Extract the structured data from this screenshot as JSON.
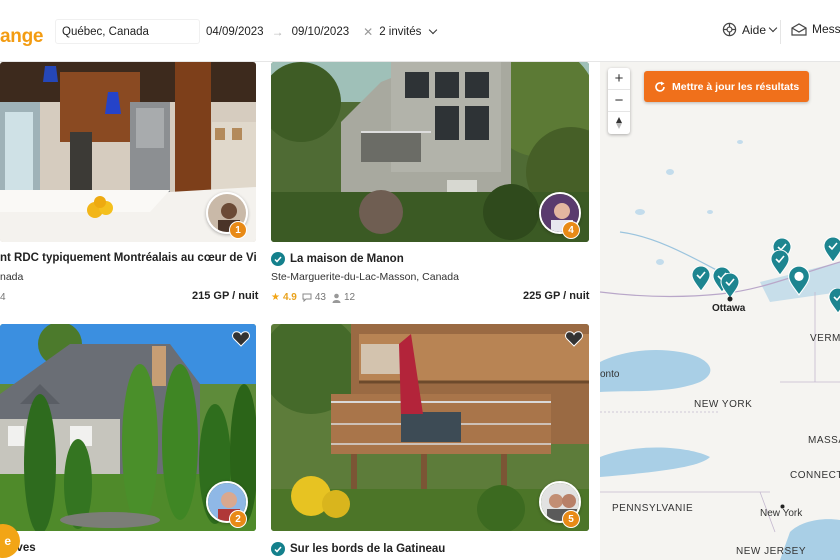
{
  "app": {
    "logo_text": "ange"
  },
  "search": {
    "location": "Québec, Canada",
    "date_from": "04/09/2023",
    "date_arrow": "→",
    "date_to": "09/10/2023",
    "clear_symbol": "✕",
    "guests": "2 invités"
  },
  "header": {
    "help_label": "Aide",
    "messages_label": "Mess"
  },
  "listings": [
    {
      "title": "nt RDC typiquement Montréalais au cœur de Vill...",
      "location": "nada",
      "price": "215 GP / nuit",
      "meta": "4",
      "badge": "1",
      "verified": false
    },
    {
      "title": "La maison de Manon",
      "location": "Ste-Marguerite-du-Lac-Masson, Canada",
      "price": "225 GP / nuit",
      "rating": "4.9",
      "reviews": "43",
      "guests": "12",
      "badge": "4",
      "verified": true
    },
    {
      "title": "e Yves",
      "badge": "2",
      "verified": false
    },
    {
      "title": "Sur les bords de la Gatineau",
      "badge": "5",
      "verified": true
    }
  ],
  "map": {
    "update_button": "Mettre à jour les résultats",
    "zoom_in": "+",
    "zoom_out": "−",
    "labels": {
      "ottawa": "Ottawa",
      "toronto": "onto",
      "new_york_state": "NEW YORK",
      "vermont": "VERMO",
      "massachusetts": "MASSA",
      "connecticut": "CONNECTI",
      "pennsylvania": "PENNSYLVANIE",
      "new_york_city": "New York",
      "new_jersey": "NEW JERSEY"
    }
  },
  "chat": {
    "label": "e"
  },
  "colors": {
    "accent": "#f0701b",
    "brand": "#f39c12",
    "teal": "#14808c",
    "badge": "#e88a17"
  }
}
